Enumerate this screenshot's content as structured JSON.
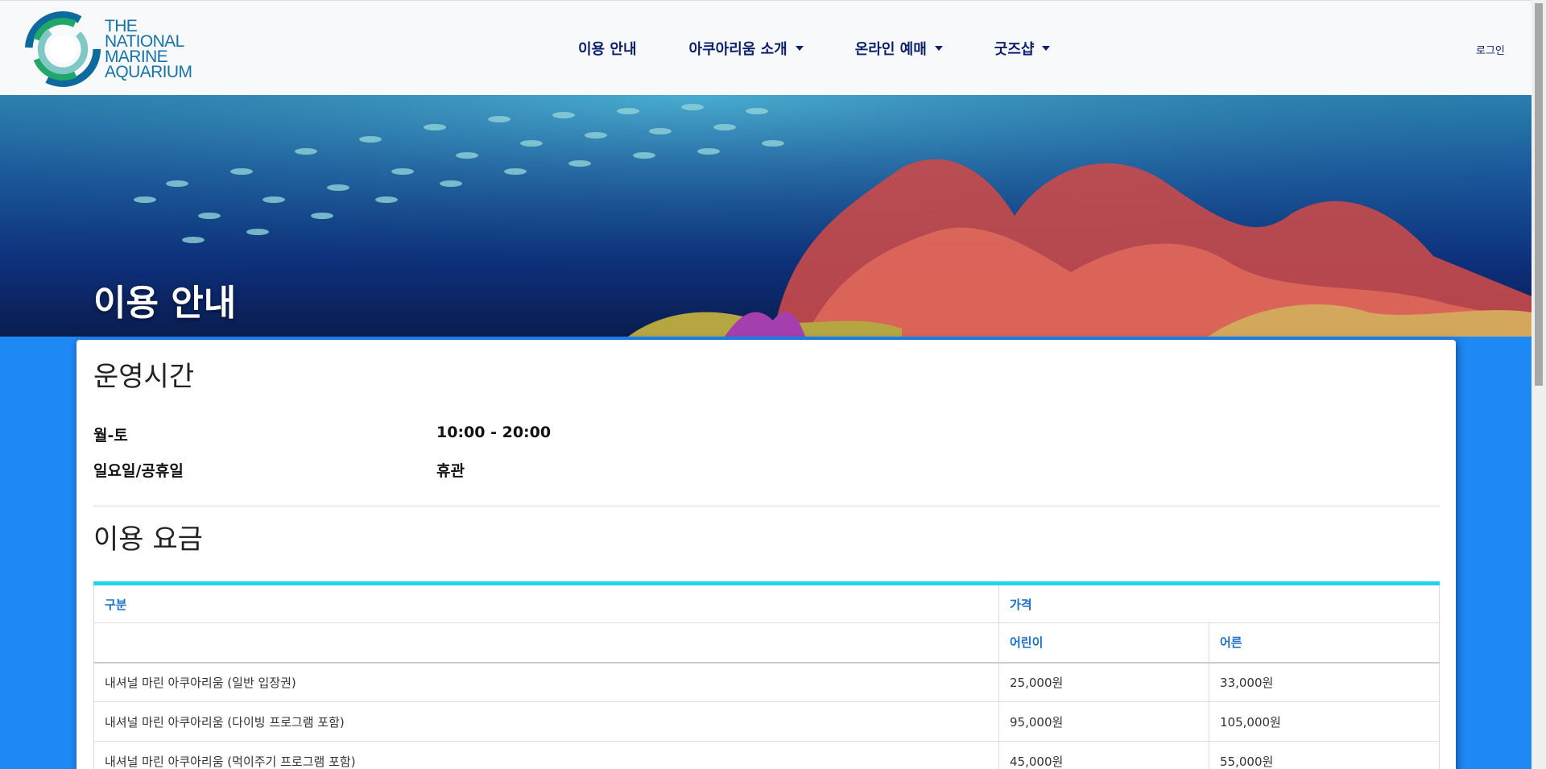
{
  "header": {
    "logo_lines": [
      "THE",
      "NATIONAL",
      "MARINE",
      "AQUARIUM"
    ],
    "nav": [
      {
        "label": "이용 안내",
        "dropdown": false
      },
      {
        "label": "아쿠아리움 소개",
        "dropdown": true
      },
      {
        "label": "온라인 예매",
        "dropdown": true
      },
      {
        "label": "굿즈샵",
        "dropdown": true
      }
    ],
    "login_label": "로그인"
  },
  "hero": {
    "title": "이용 안내"
  },
  "hours": {
    "title": "운영시간",
    "rows": [
      {
        "label": "월-토",
        "value": "10:00 - 20:00"
      },
      {
        "label": "일요일/공휴일",
        "value": "휴관"
      }
    ]
  },
  "pricing": {
    "title": "이용 요금",
    "headers": {
      "category": "구분",
      "price": "가격",
      "child": "어린이",
      "adult": "어른"
    },
    "rows": [
      {
        "name": "내셔널 마린 아쿠아리움 (일반 입장권)",
        "child": "25,000원",
        "adult": "33,000원"
      },
      {
        "name": "내셔널 마린 아쿠아리움 (다이빙 프로그램 포함)",
        "child": "95,000원",
        "adult": "105,000원"
      },
      {
        "name": "내셔널 마린 아쿠아리움 (먹이주기 프로그램 포함)",
        "child": "45,000원",
        "adult": "55,000원"
      }
    ]
  },
  "colors": {
    "page_bg": "#1e88f5",
    "nav_text": "#0c1f6b",
    "table_accent": "#22d3ee",
    "table_header": "#1b6fc4"
  }
}
